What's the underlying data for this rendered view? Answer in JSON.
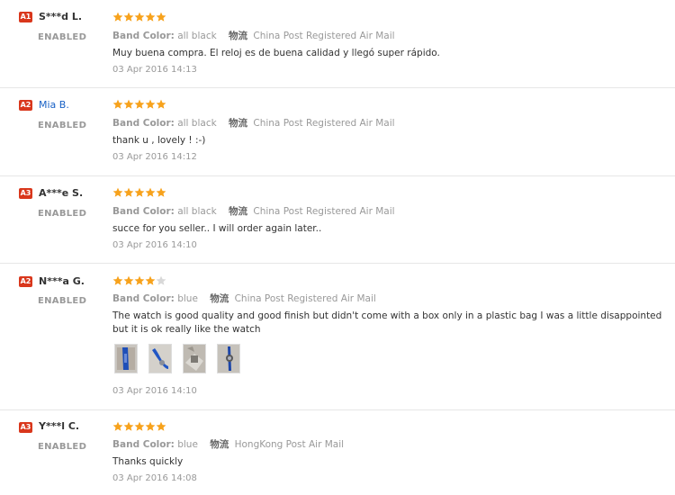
{
  "colors": {
    "badge": "#d9371c",
    "star_on": "#f7a21c",
    "star_off": "#d8d8d8",
    "link": "#1a62c6"
  },
  "reviews": [
    {
      "badge": "A1",
      "name": "S***d L.",
      "status": "ENABLED",
      "rating": 5,
      "meta_label": "Band Color:",
      "band_color": "all black",
      "ship_icon": "物流",
      "shipping": "China Post Registered Air Mail",
      "text": "Muy buena compra. El reloj es de buena calidad y llegó super rápido.",
      "date": "03 Apr 2016 14:13"
    },
    {
      "badge": "A2",
      "name": "Mia B.",
      "status": "ENABLED",
      "rating": 5,
      "meta_label": "Band Color:",
      "band_color": "all black",
      "ship_icon": "物流",
      "shipping": "China Post Registered Air Mail",
      "text": "thank u , lovely ! :-)",
      "date": "03 Apr 2016 14:12"
    },
    {
      "badge": "A3",
      "name": "A***e S.",
      "status": "ENABLED",
      "rating": 5,
      "meta_label": "Band Color:",
      "band_color": "all black",
      "ship_icon": "物流",
      "shipping": "China Post Registered Air Mail",
      "text": "succe for you seller.. I will order again later..",
      "date": "03 Apr 2016 14:10"
    },
    {
      "badge": "A2",
      "name": "N***a G.",
      "status": "ENABLED",
      "rating": 4,
      "meta_label": "Band Color:",
      "band_color": "blue",
      "ship_icon": "物流",
      "shipping": "China Post Registered Air Mail",
      "text": "The watch is good quality and good finish but didn't come with a box only in a plastic bag I was a little disappointed but it is ok really like the watch",
      "date": "03 Apr 2016 14:10"
    },
    {
      "badge": "A3",
      "name": "Y***l C.",
      "status": "ENABLED",
      "rating": 5,
      "meta_label": "Band Color:",
      "band_color": "blue",
      "ship_icon": "物流",
      "shipping": "HongKong Post Air Mail",
      "text": "Thanks quickly",
      "date": "03 Apr 2016 14:08"
    }
  ]
}
